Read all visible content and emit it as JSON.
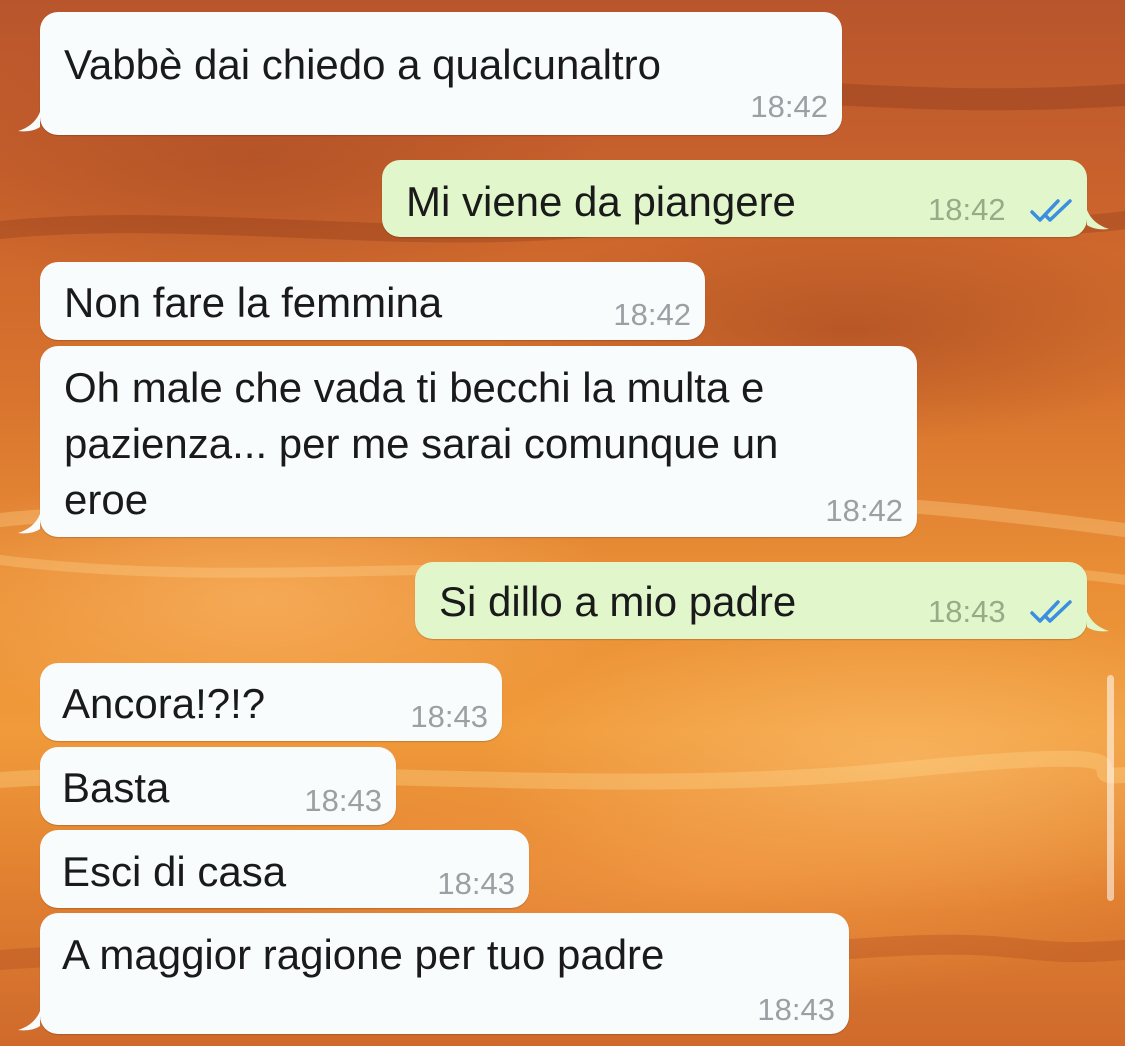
{
  "conversation": {
    "messages": [
      {
        "direction": "incoming",
        "text": "Vabbè dai chiedo a qualcunaltro",
        "time": "18:42"
      },
      {
        "direction": "outgoing",
        "text": "Mi viene da piangere",
        "time": "18:42",
        "read_status": "read"
      },
      {
        "direction": "incoming",
        "text": "Non fare la femmina",
        "time": "18:42"
      },
      {
        "direction": "incoming",
        "text": "Oh male che vada ti becchi la multa e\npazienza... per me sarai comunque un\neroe",
        "time": "18:42"
      },
      {
        "direction": "outgoing",
        "text": "Si dillo a mio padre",
        "time": "18:43",
        "read_status": "read"
      },
      {
        "direction": "incoming",
        "text": "Ancora!?!?",
        "time": "18:43"
      },
      {
        "direction": "incoming",
        "text": "Basta",
        "time": "18:43"
      },
      {
        "direction": "incoming",
        "text": "Esci di casa",
        "time": "18:43"
      },
      {
        "direction": "incoming",
        "text": "A maggior ragione per tuo padre",
        "time": "18:43"
      }
    ]
  },
  "colors": {
    "incoming_bubble": "#f8fcfd",
    "outgoing_bubble": "#e1f7cb",
    "read_ticks": "#3b8fe0",
    "wallpaper": "#e07f30"
  },
  "icons": {
    "read_receipt": "double-check-icon"
  }
}
